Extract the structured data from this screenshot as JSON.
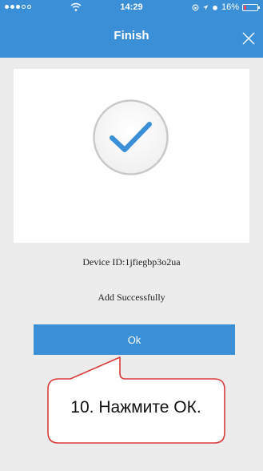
{
  "status_bar": {
    "time": "14:29",
    "battery_percent": "16%",
    "battery_level": 0.16,
    "signal_icon": "signal-dots-icon",
    "wifi_icon": "wifi-icon"
  },
  "nav": {
    "title": "Finish",
    "close_icon": "close-icon"
  },
  "colors": {
    "accent": "#3a8fd6",
    "background": "#ececec",
    "card": "#ffffff",
    "check": "#3a8fd6",
    "callout_border": "#d93b3b"
  },
  "result": {
    "icon": "checkmark-circle-icon",
    "device_id_text": "Device ID:1jfiegbp3o2ua",
    "message": "Add Successfully"
  },
  "ok_button": {
    "label": "Ok"
  },
  "annotation": {
    "text": "10. Нажмите ОК."
  }
}
